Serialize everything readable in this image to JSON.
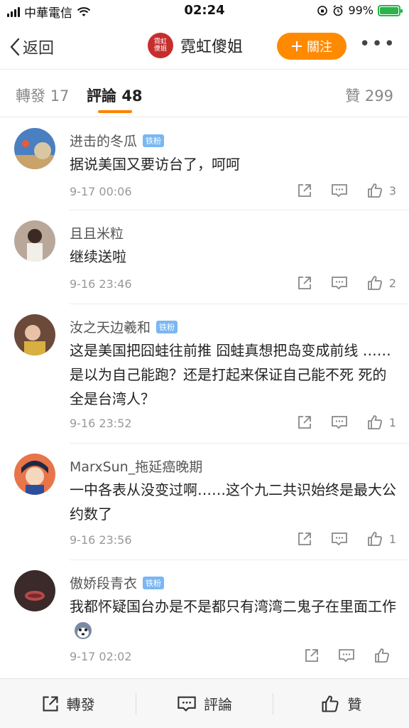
{
  "status": {
    "carrier": "中華電信",
    "time": "02:24",
    "battery": "99%"
  },
  "header": {
    "back_label": "返回",
    "title": "霓虹傻姐",
    "avatar_text": "霓虹\n傻姐",
    "follow_label": "關注",
    "more": "•••"
  },
  "tabs": {
    "repost": {
      "label": "轉發",
      "count": "17"
    },
    "comment": {
      "label": "評論",
      "count": "48"
    },
    "like": {
      "label": "贊",
      "count": "299"
    }
  },
  "comments": [
    {
      "name": "进击的冬瓜",
      "badge": "铁粉",
      "text": "据说美国又要访台了，呵呵",
      "time": "9-17 00:06",
      "likes": "3"
    },
    {
      "name": "且且米粒",
      "badge": "",
      "text": "继续送啦",
      "time": "9-16 23:46",
      "likes": "2"
    },
    {
      "name": "汝之天边羲和",
      "badge": "铁粉",
      "text": "这是美国把囧蛙往前推 囧蛙真想把岛变成前线 ……是以为自己能跑？还是打起来保证自己能不死 死的全是台湾人？",
      "time": "9-16 23:52",
      "likes": "1"
    },
    {
      "name": "MarxSun_拖延癌晚期",
      "badge": "",
      "text": "一中各表从没变过啊……这个九二共识始终是最大公约数了",
      "time": "9-16 23:56",
      "likes": "1"
    },
    {
      "name": "傲娇段青衣",
      "badge": "铁粉",
      "text": "我都怀疑国台办是不是都只有湾湾二鬼子在里面工作",
      "time": "9-17 02:02",
      "likes": ""
    }
  ],
  "bottom_bar": {
    "repost": "轉發",
    "comment": "評論",
    "like": "贊"
  },
  "colors": {
    "accent": "#ff8200",
    "follow": "#ff8a00",
    "badge": "#7ab7f2",
    "battery": "#2ab44a"
  }
}
